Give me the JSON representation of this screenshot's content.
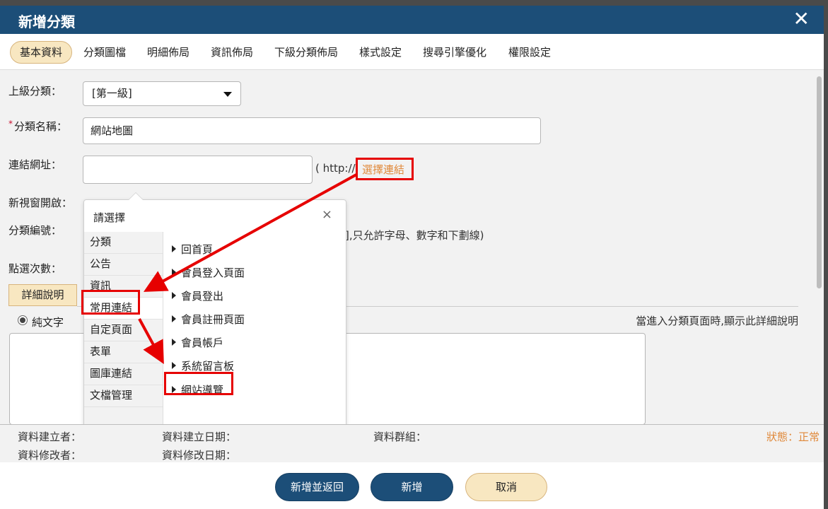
{
  "dialog": {
    "title": "新增分類",
    "close_glyph": "✕"
  },
  "tabs": [
    {
      "label": "基本資料",
      "active": true
    },
    {
      "label": "分類圖檔"
    },
    {
      "label": "明細佈局"
    },
    {
      "label": "資訊佈局"
    },
    {
      "label": "下級分類佈局"
    },
    {
      "label": "樣式設定"
    },
    {
      "label": "搜尋引擎優化"
    },
    {
      "label": "權限設定"
    }
  ],
  "form": {
    "parent_label": "上級分類：",
    "parent_value": "[第一級]",
    "required_mark": "*",
    "name_label": "分類名稱：",
    "name_value": "網站地圖",
    "url_label": "連結網址：",
    "url_value": "",
    "url_hint": "( http://",
    "choose_link": "選擇連結",
    "new_window_label": "新視窗開啟：",
    "code_label": "分類編號：",
    "code_hint": "],只允許字母、數字和下劃線)",
    "clicks_label": "點選次數：",
    "detail_tab": "詳細說明",
    "radio_label": "純文字",
    "detail_hint": "當進入分類頁面時,顯示此詳細說明"
  },
  "popup": {
    "title": "請選擇",
    "close_glyph": "×",
    "categories": [
      "分類",
      "公告",
      "資訊",
      "常用連結",
      "自定頁面",
      "表單",
      "圖庫連結",
      "文檔管理"
    ],
    "selected_category": "常用連結",
    "links": [
      "回首頁",
      "會員登入頁面",
      "會員登出",
      "會員註冊頁面",
      "會員帳戶",
      "系統留言板",
      "網站導覽"
    ],
    "highlighted_link": "網站導覽"
  },
  "footer": {
    "creator": "資料建立者：",
    "created_date": "資料建立日期：",
    "group": "資料群組：",
    "status": "狀態：正常",
    "modifier": "資料修改者：",
    "modified_date": "資料修改日期："
  },
  "buttons": {
    "add_return": "新增並返回",
    "add": "新增",
    "cancel": "取消"
  },
  "colors": {
    "header": "#1c4e78",
    "accent_tab": "#f8e7c1",
    "link": "#e08a3c",
    "annotation": "#e60000"
  }
}
